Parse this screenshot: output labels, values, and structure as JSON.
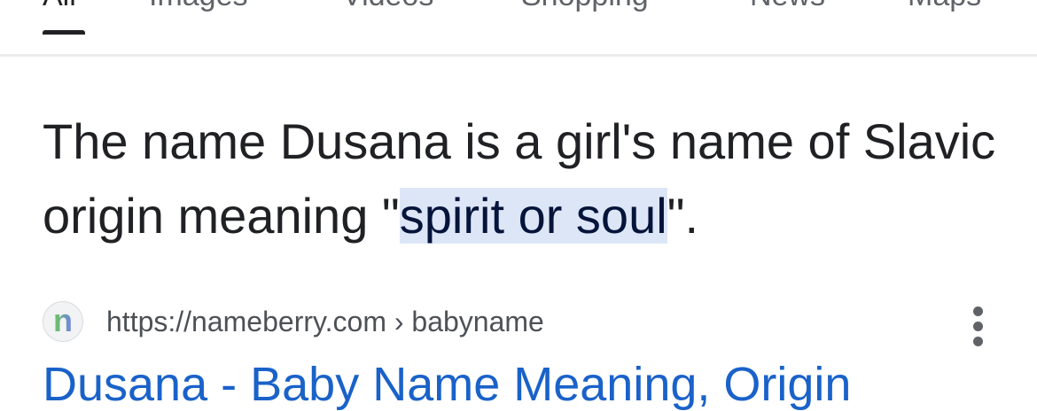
{
  "tabs": [
    {
      "label": "All",
      "active": true
    },
    {
      "label": "Images",
      "active": false
    },
    {
      "label": "Videos",
      "active": false
    },
    {
      "label": "Shopping",
      "active": false
    },
    {
      "label": "News",
      "active": false
    },
    {
      "label": "Maps",
      "active": false
    }
  ],
  "answer": {
    "text_before": "The name Dusana is a girl's name of Slavic origin meaning \"",
    "highlight": "spirit or soul",
    "text_after": "\"."
  },
  "source": {
    "favicon_letter": "n",
    "url": "https://nameberry.com › babyname",
    "more_icon": "more-vert-icon"
  },
  "result": {
    "title": "Dusana - Baby Name Meaning, Origin"
  },
  "colors": {
    "highlight": "#dde6f7",
    "link": "#1a62c9",
    "tab_indicator": "#202124"
  }
}
